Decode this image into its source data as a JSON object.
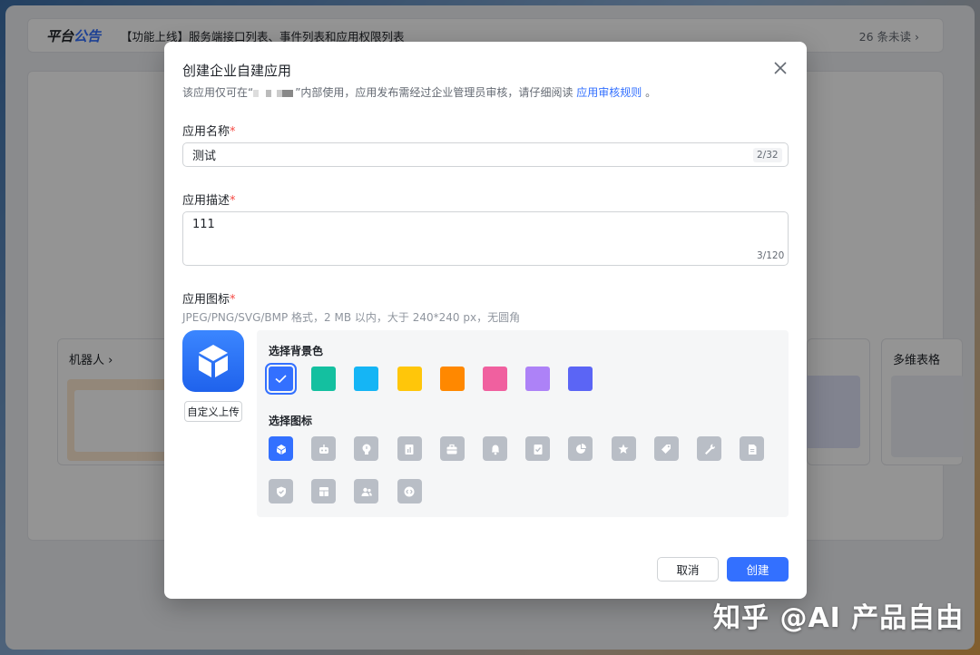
{
  "notice": {
    "brand_part1": "平台",
    "brand_part2": "公告",
    "text": "【功能上线】服务端接口列表、事件列表和应用权限列表",
    "unread": "26 条未读 ›"
  },
  "background_cards": {
    "left_title": "机器人 ›",
    "right_title": "多维表格"
  },
  "modal": {
    "title": "创建企业自建应用",
    "desc_prefix": "该应用仅可在“",
    "desc_suffix": "”内部使用，应用发布需经过企业管理员审核，请仔细阅读",
    "desc_link": "应用审核规则",
    "desc_end": "。",
    "name_field": {
      "label": "应用名称",
      "required_mark": "*",
      "value": "测试",
      "counter": "2/32"
    },
    "desc_field": {
      "label": "应用描述",
      "required_mark": "*",
      "value": "111",
      "counter": "3/120"
    },
    "icon_field": {
      "label": "应用图标",
      "required_mark": "*",
      "hint": "JPEG/PNG/SVG/BMP 格式，2 MB 以内，大于 240*240 px，无圆角",
      "upload_label": "自定义上传"
    },
    "bg_picker": {
      "title": "选择背景色",
      "colors": [
        "#3370ff",
        "#14c0a0",
        "#15b5f5",
        "#ffc60a",
        "#ff8800",
        "#f0609f",
        "#ad82f7",
        "#5b65f5"
      ],
      "selected_index": 0
    },
    "icon_picker": {
      "title": "选择图标",
      "icons": [
        "cube-icon",
        "robot-icon",
        "bulb-icon",
        "document-chart-icon",
        "briefcase-icon",
        "bell-icon",
        "checklist-icon",
        "pie-chart-icon",
        "star-icon",
        "tag-icon",
        "wrench-icon",
        "file-icon",
        "shield-icon",
        "layout-icon",
        "users-icon",
        "code-icon"
      ],
      "selected_index": 0
    },
    "cancel_label": "取消",
    "create_label": "创建"
  },
  "watermark": "知乎 @AI 产品自由"
}
